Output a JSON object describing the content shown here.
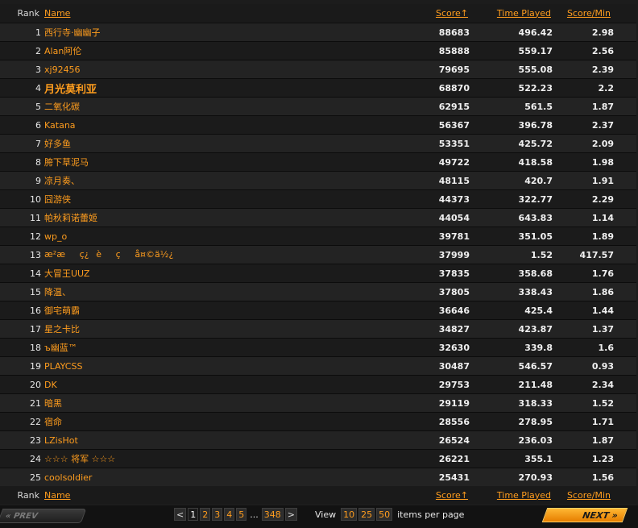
{
  "table": {
    "headers": {
      "rank": "Rank",
      "name": "Name",
      "score": "Score↑",
      "time": "Time Played",
      "spm": "Score/Min"
    },
    "rows": [
      {
        "rank": "1",
        "name": "西行寺·幽幽子",
        "score": "88683",
        "time": "496.42",
        "spm": "2.98"
      },
      {
        "rank": "2",
        "name": "Alan阿伦",
        "score": "85888",
        "time": "559.17",
        "spm": "2.56"
      },
      {
        "rank": "3",
        "name": "xj92456",
        "score": "79695",
        "time": "555.08",
        "spm": "2.39"
      },
      {
        "rank": "4",
        "name": "月光莫利亚",
        "score": "68870",
        "time": "522.23",
        "spm": "2.2"
      },
      {
        "rank": "5",
        "name": "二氧化碳",
        "score": "62915",
        "time": "561.5",
        "spm": "1.87"
      },
      {
        "rank": "6",
        "name": "Katana",
        "score": "56367",
        "time": "396.78",
        "spm": "2.37"
      },
      {
        "rank": "7",
        "name": "好多鱼",
        "score": "53351",
        "time": "425.72",
        "spm": "2.09"
      },
      {
        "rank": "8",
        "name": "胯下草泥马",
        "score": "49722",
        "time": "418.58",
        "spm": "1.98"
      },
      {
        "rank": "9",
        "name": "凉月奏、",
        "score": "48115",
        "time": "420.7",
        "spm": "1.91"
      },
      {
        "rank": "10",
        "name": "囧游侠",
        "score": "44373",
        "time": "322.77",
        "spm": "2.29"
      },
      {
        "rank": "11",
        "name": "帕秋莉诺蕾姬",
        "score": "44054",
        "time": "643.83",
        "spm": "1.14"
      },
      {
        "rank": "12",
        "name": "wp_o",
        "score": "39781",
        "time": "351.05",
        "spm": "1.89"
      },
      {
        "rank": "13",
        "name": "æ²æç¿èçå¤©ä½¿",
        "score": "37999",
        "time": "1.52",
        "spm": "417.57"
      },
      {
        "rank": "14",
        "name": "大冒王UUZ",
        "score": "37835",
        "time": "358.68",
        "spm": "1.76"
      },
      {
        "rank": "15",
        "name": "降温、",
        "score": "37805",
        "time": "338.43",
        "spm": "1.86"
      },
      {
        "rank": "16",
        "name": "御宅萌霸",
        "score": "36646",
        "time": "425.4",
        "spm": "1.44"
      },
      {
        "rank": "17",
        "name": "星之卡比",
        "score": "34827",
        "time": "423.87",
        "spm": "1.37"
      },
      {
        "rank": "18",
        "name": "ъ幽蓝™",
        "score": "32630",
        "time": "339.8",
        "spm": "1.6"
      },
      {
        "rank": "19",
        "name": "PLAYCSS",
        "score": "30487",
        "time": "546.57",
        "spm": "0.93"
      },
      {
        "rank": "20",
        "name": "DK",
        "score": "29753",
        "time": "211.48",
        "spm": "2.34"
      },
      {
        "rank": "21",
        "name": "暗黑",
        "score": "29119",
        "time": "318.33",
        "spm": "1.52"
      },
      {
        "rank": "22",
        "name": "宿命",
        "score": "28556",
        "time": "278.95",
        "spm": "1.71"
      },
      {
        "rank": "23",
        "name": "LZisHot",
        "score": "26524",
        "time": "236.03",
        "spm": "1.87"
      },
      {
        "rank": "24",
        "name": "☆☆☆ 将军 ☆☆☆",
        "score": "26221",
        "time": "355.1",
        "spm": "1.23"
      },
      {
        "rank": "25",
        "name": "coolsoldier",
        "score": "25431",
        "time": "270.93",
        "spm": "1.56"
      }
    ]
  },
  "pagination": {
    "prev_label": "« PREV",
    "next_label": "NEXT »",
    "prev_arrow": "<",
    "next_arrow": ">",
    "pages": [
      "1",
      "2",
      "3",
      "4",
      "5"
    ],
    "current_page": "1",
    "ellipsis": "...",
    "last_page": "348",
    "view_label": "View",
    "per_page_options": [
      "10",
      "25",
      "50"
    ],
    "per_page_suffix": "items per page"
  },
  "colors": {
    "accent": "#ff9d1e",
    "row_odd": "#232323",
    "row_even": "#1b1b1b"
  }
}
